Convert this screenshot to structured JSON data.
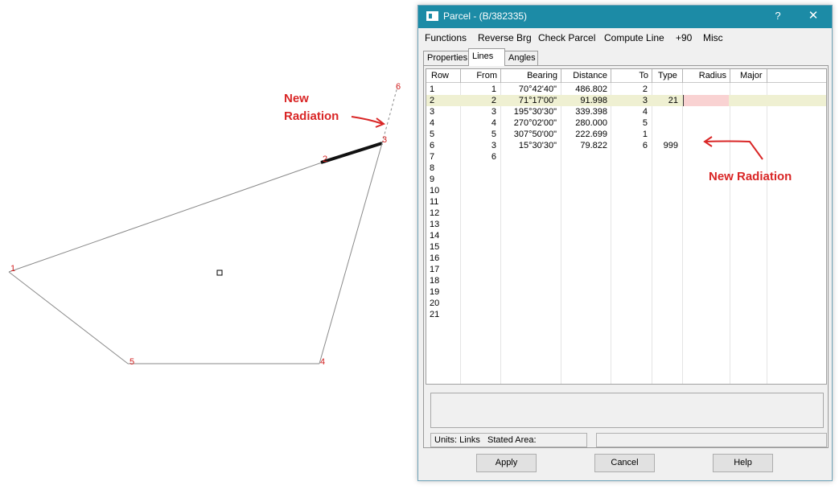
{
  "drawing": {
    "points": [
      {
        "label": "1"
      },
      {
        "label": "2"
      },
      {
        "label": "3"
      },
      {
        "label": "4"
      },
      {
        "label": "5"
      },
      {
        "label": "6"
      }
    ],
    "annotation_top": {
      "line1": "New",
      "line2": "Radiation"
    },
    "annotation_right": "New Radiation",
    "annotation_color": "#d92626"
  },
  "dialog": {
    "title": "Parcel - (B/382335)",
    "help_glyph": "?",
    "close_glyph": "✕",
    "menu": [
      "Functions",
      "Reverse Brg",
      "Check Parcel",
      "Compute Line",
      "+90",
      "Misc"
    ],
    "tabs": [
      "Properties",
      "Lines",
      "Angles"
    ],
    "active_tab": "Lines",
    "columns": [
      "Row",
      "From",
      "Bearing",
      "Distance",
      "To",
      "Type",
      "Radius",
      "Major"
    ],
    "rows": [
      {
        "row": "1",
        "from": "1",
        "bearing": "70°42'40\"",
        "distance": "486.802",
        "to": "2",
        "type": ""
      },
      {
        "row": "2",
        "from": "2",
        "bearing": "71°17'00\"",
        "distance": "91.998",
        "to": "3",
        "type": "21"
      },
      {
        "row": "3",
        "from": "3",
        "bearing": "195°30'30\"",
        "distance": "339.398",
        "to": "4",
        "type": ""
      },
      {
        "row": "4",
        "from": "4",
        "bearing": "270°02'00\"",
        "distance": "280.000",
        "to": "5",
        "type": ""
      },
      {
        "row": "5",
        "from": "5",
        "bearing": "307°50'00\"",
        "distance": "222.699",
        "to": "1",
        "type": ""
      },
      {
        "row": "6",
        "from": "3",
        "bearing": "15°30'30\"",
        "distance": "79.822",
        "to": "6",
        "type": "999"
      },
      {
        "row": "7",
        "from": "6",
        "bearing": "",
        "distance": "",
        "to": "",
        "type": ""
      },
      {
        "row": "8",
        "from": "",
        "bearing": "",
        "distance": "",
        "to": "",
        "type": ""
      },
      {
        "row": "9",
        "from": "",
        "bearing": "",
        "distance": "",
        "to": "",
        "type": ""
      },
      {
        "row": "10",
        "from": "",
        "bearing": "",
        "distance": "",
        "to": "",
        "type": ""
      },
      {
        "row": "11",
        "from": "",
        "bearing": "",
        "distance": "",
        "to": "",
        "type": ""
      },
      {
        "row": "12",
        "from": "",
        "bearing": "",
        "distance": "",
        "to": "",
        "type": ""
      },
      {
        "row": "13",
        "from": "",
        "bearing": "",
        "distance": "",
        "to": "",
        "type": ""
      },
      {
        "row": "14",
        "from": "",
        "bearing": "",
        "distance": "",
        "to": "",
        "type": ""
      },
      {
        "row": "15",
        "from": "",
        "bearing": "",
        "distance": "",
        "to": "",
        "type": ""
      },
      {
        "row": "16",
        "from": "",
        "bearing": "",
        "distance": "",
        "to": "",
        "type": ""
      },
      {
        "row": "17",
        "from": "",
        "bearing": "",
        "distance": "",
        "to": "",
        "type": ""
      },
      {
        "row": "18",
        "from": "",
        "bearing": "",
        "distance": "",
        "to": "",
        "type": ""
      },
      {
        "row": "19",
        "from": "",
        "bearing": "",
        "distance": "",
        "to": "",
        "type": ""
      },
      {
        "row": "20",
        "from": "",
        "bearing": "",
        "distance": "",
        "to": "",
        "type": ""
      },
      {
        "row": "21",
        "from": "",
        "bearing": "",
        "distance": "",
        "to": "",
        "type": ""
      }
    ],
    "selected_row": "2",
    "status_units": "Units: Links",
    "status_area": "Stated Area:",
    "buttons": {
      "apply": "Apply",
      "cancel": "Cancel",
      "help": "Help"
    },
    "colors": {
      "titlebar": "#1c8ba6",
      "selected_row": "#eff0d2",
      "radius_edit": "#f9d2d2"
    }
  }
}
